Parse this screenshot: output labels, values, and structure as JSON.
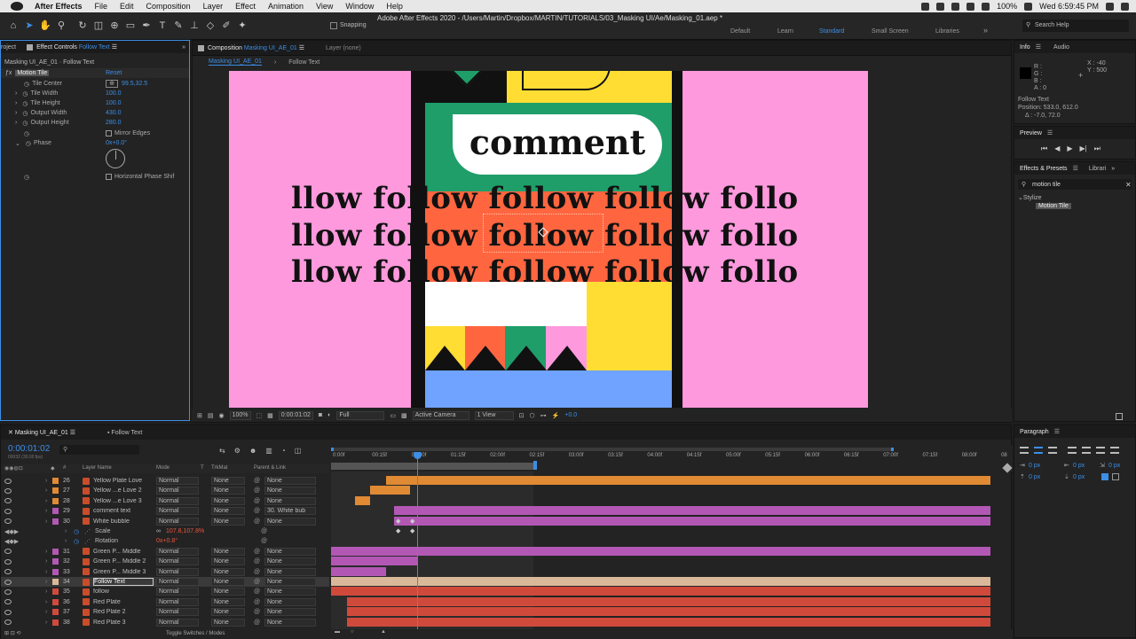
{
  "menubar": {
    "app": "After Effects",
    "items": [
      "File",
      "Edit",
      "Composition",
      "Layer",
      "Effect",
      "Animation",
      "View",
      "Window",
      "Help"
    ],
    "battery": "100%",
    "clock": "Wed 6:59:45 PM"
  },
  "window_title": "Adobe After Effects 2020 - /Users/Martin/Dropbox/MARTIN/TUTORIALS/03_Masking UI/Ae/Masking_01.aep *",
  "toolbar": {
    "snapping": "Snapping",
    "workspaces": [
      "Default",
      "Learn",
      "Standard",
      "Small Screen",
      "Libraries"
    ],
    "active_workspace": "Standard",
    "search_help": "Search Help"
  },
  "effect_controls": {
    "project_tab": "roject",
    "tab_label": "Effect Controls",
    "tab_layer": "Follow Text",
    "header": "Masking UI_AE_01 · Follow Text",
    "effect_name": "Motion Tile",
    "reset": "Reset",
    "props": [
      {
        "label": "Tile Center",
        "value": "99.5,32.5"
      },
      {
        "label": "Tile Width",
        "value": "100.0"
      },
      {
        "label": "Tile Height",
        "value": "100.0"
      },
      {
        "label": "Output Width",
        "value": "430.0"
      },
      {
        "label": "Output Height",
        "value": "280.0"
      }
    ],
    "mirror_edges": "Mirror Edges",
    "phase_label": "Phase",
    "phase_value": "0x+0.0°",
    "horizontal_phase": "Horizontal Phase Shif"
  },
  "composition": {
    "tab_label": "Composition",
    "tab_comp": "Masking UI_AE_01",
    "layer_tab": "Layer (none)",
    "breadcrumb_1": "Masking UI_AE_01",
    "breadcrumb_2": "Follow Text",
    "canvas_word": "comment",
    "tile_rows": [
      "llow follow follow follow follo",
      "llow follow follow follow follo",
      "llow follow follow follow follo"
    ],
    "colors": {
      "pink": "#ff99dd",
      "green": "#1f9e6a",
      "orange": "#ff6640",
      "yellow": "#ffdd33",
      "blue": "#6fa3ff",
      "black": "#111111"
    },
    "footer": {
      "zoom": "100%",
      "timecode": "0:00:01:02",
      "resolution": "Full",
      "camera": "Active Camera",
      "view": "1 View",
      "exposure": "+0.0"
    }
  },
  "info_panel": {
    "tab": "Info",
    "tab2": "Audio",
    "r": "R :",
    "g": "G :",
    "b": "B :",
    "a": "A : 0",
    "x": "X : -40",
    "y": "Y : 500",
    "layer": "Follow Text",
    "position": "Position: 533.0, 612.0",
    "delta": "Δ : -7.0, 72.0"
  },
  "preview_panel": {
    "tab": "Preview"
  },
  "effects_presets": {
    "tab": "Effects & Presets",
    "tab2": "Librari",
    "search": "motion tile",
    "category": "Stylize",
    "item": "Motion Tile"
  },
  "timeline": {
    "tab": "Masking UI_AE_01",
    "tab2": "Follow Text",
    "timecode": "0:00:01:02",
    "frames": "00032 (30.00 fps)",
    "col_layer": "Layer Name",
    "col_mode": "Mode",
    "col_t": "T",
    "col_trkmat": "TrkMat",
    "col_parent": "Parent & Link",
    "ruler": [
      "0:00f",
      "00:15f",
      "01:00f",
      "01:15f",
      "02:00f",
      "02:15f",
      "03:00f",
      "03:15f",
      "04:00f",
      "04:15f",
      "05:00f",
      "05:15f",
      "06:00f",
      "06:15f",
      "07:00f",
      "07:15f",
      "08:00f",
      "08"
    ],
    "layers": [
      {
        "num": "26",
        "name": "Yellow Plate Love",
        "mode": "Normal",
        "trk": "None",
        "parent": "None",
        "color": "#e08a34"
      },
      {
        "num": "27",
        "name": "Yellow ...e Love 2",
        "mode": "Normal",
        "trk": "None",
        "parent": "None",
        "color": "#e08a34"
      },
      {
        "num": "28",
        "name": "Yellow ...e Love 3",
        "mode": "Normal",
        "trk": "None",
        "parent": "None",
        "color": "#e08a34"
      },
      {
        "num": "29",
        "name": "comment text",
        "mode": "Normal",
        "trk": "None",
        "parent": "30. White bub",
        "color": "#b258b4"
      },
      {
        "num": "30",
        "name": "White bubble",
        "mode": "Normal",
        "trk": "None",
        "parent": "None",
        "color": "#b258b4"
      },
      {
        "num": "31",
        "name": "Green P... Middle",
        "mode": "Normal",
        "trk": "None",
        "parent": "None",
        "color": "#b258b4"
      },
      {
        "num": "32",
        "name": "Green P... Middle 2",
        "mode": "Normal",
        "trk": "None",
        "parent": "None",
        "color": "#b258b4"
      },
      {
        "num": "33",
        "name": "Green P... Middle 3",
        "mode": "Normal",
        "trk": "None",
        "parent": "None",
        "color": "#b258b4"
      },
      {
        "num": "34",
        "name": "Follow Text",
        "mode": "Normal",
        "trk": "None",
        "parent": "None",
        "color": "#d9b99a"
      },
      {
        "num": "35",
        "name": "follow",
        "mode": "Normal",
        "trk": "None",
        "parent": "None",
        "color": "#d04a3c"
      },
      {
        "num": "36",
        "name": "Red Plate",
        "mode": "Normal",
        "trk": "None",
        "parent": "None",
        "color": "#d04a3c"
      },
      {
        "num": "37",
        "name": "Red Plate 2",
        "mode": "Normal",
        "trk": "None",
        "parent": "None",
        "color": "#d04a3c"
      },
      {
        "num": "38",
        "name": "Red Plate 3",
        "mode": "Normal",
        "trk": "None",
        "parent": "None",
        "color": "#d04a3c"
      }
    ],
    "scale_label": "Scale",
    "scale_value": "107.8,107.8%",
    "rotation_label": "Rotation",
    "rotation_value": "0x+0.8°",
    "toggle": "Toggle Switches / Modes"
  },
  "paragraph": {
    "tab": "Paragraph",
    "px_values": [
      "0 px",
      "0 px",
      "0 px",
      "0 px",
      "0 px"
    ]
  }
}
